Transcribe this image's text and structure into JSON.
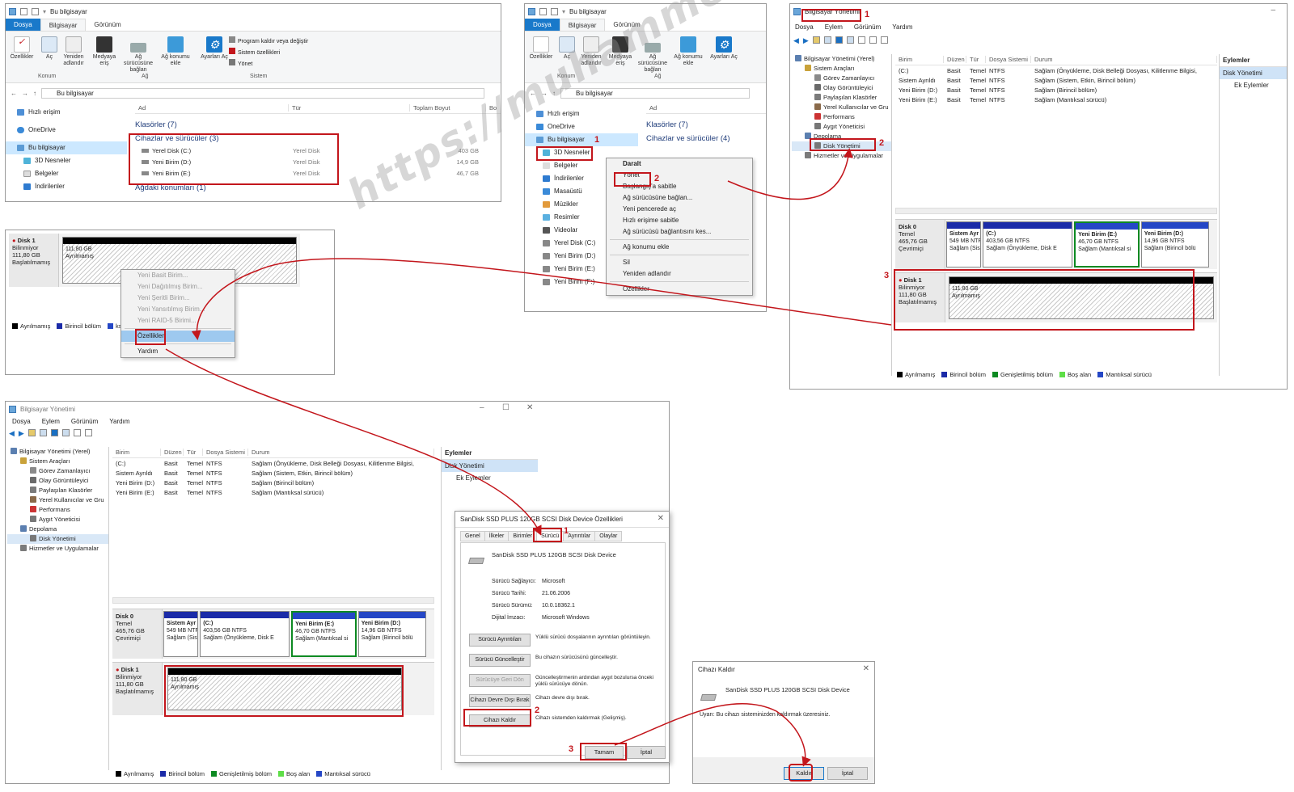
{
  "watermark": "https://muhammedyusufolgun.blogspot.com",
  "explorer": {
    "title": "Bu bilgisayar",
    "tabs": [
      "Dosya",
      "Bilgisayar",
      "Görünüm"
    ],
    "ribbon": {
      "items": [
        "Özellikler",
        "Aç",
        "Yeniden adlandır",
        "Medyaya eriş",
        "Ağ sürücüsüne bağlan",
        "Ağ konumu ekle",
        "Ayarları Aç"
      ],
      "system_items": [
        "Program kaldır veya değiştir",
        "Sistem özellikleri",
        "Yönet"
      ],
      "groups": [
        "Konum",
        "Ağ",
        "Sistem"
      ]
    },
    "address": "Bu bilgisayar",
    "nav": [
      "Hızlı erişim",
      "OneDrive",
      "Bu bilgisayar",
      "3D Nesneler",
      "Belgeler",
      "İndirilenler"
    ],
    "columns": [
      "Ad",
      "Tür",
      "Toplam Boyut",
      "Bo"
    ],
    "folders_group": "Klasörler (7)",
    "devices_group": "Cihazlar ve sürücüler (3)",
    "drives": [
      {
        "name": "Yerel Disk (C:)",
        "type": "Yerel Disk",
        "size": "403 GB"
      },
      {
        "name": "Yeni Birim (D:)",
        "type": "Yerel Disk",
        "size": "14,9 GB"
      },
      {
        "name": "Yeni Birim (E:)",
        "type": "Yerel Disk",
        "size": "46,7 GB"
      }
    ],
    "network_group": "Ağdaki konumları (1)"
  },
  "explorer2": {
    "title": "Bu bilgisayar",
    "tabs": [
      "Dosya",
      "Bilgisayar",
      "Görünüm"
    ],
    "ribbon_items": [
      "Özellikler",
      "Aç",
      "Yeniden adlandır",
      "Medyaya eriş",
      "Ağ sürücüsüne bağlan",
      "Ağ konumu ekle",
      "Ayarları Aç"
    ],
    "groups": [
      "Konum",
      "Ağ"
    ],
    "address": "Bu bilgisayar",
    "nav": [
      "Hızlı erişim",
      "OneDrive",
      "Bu bilgisayar",
      "3D Nesneler",
      "Belgeler",
      "İndirilenler",
      "Masaüstü",
      "Müzikler",
      "Resimler",
      "Videolar",
      "Yerel Disk (C:)",
      "Yeni Birim (D:)",
      "Yeni Birim (E:)",
      "Yeni Birim (F:)"
    ],
    "col_ad": "Ad",
    "folders_group": "Klasörler (7)",
    "devices_group": "Cihazlar ve sürücüler (4)",
    "context_menu": [
      "Daralt",
      "Yönet",
      "Başlangıç'a sabitle",
      "Ağ sürücüsüne bağlan...",
      "Yeni pencerede aç",
      "Hızlı erişime sabitle",
      "Ağ sürücüsü bağlantısını kes...",
      "Ağ konumu ekle",
      "Sil",
      "Yeniden adlandır",
      "Özellikler"
    ],
    "step1": "1",
    "step2": "2"
  },
  "compmgmt": {
    "title": "Bilgisayar Yönetimi",
    "menu": [
      "Dosya",
      "Eylem",
      "Görünüm",
      "Yardım"
    ],
    "tree": [
      "Bilgisayar Yönetimi (Yerel)",
      "Sistem Araçları",
      "Görev Zamanlayıcı",
      "Olay Görüntüleyici",
      "Paylaşılan Klasörler",
      "Yerel Kullanıcılar ve Gru",
      "Performans",
      "Aygıt Yöneticisi",
      "Depolama",
      "Disk Yönetimi",
      "Hizmetler ve Uygulamalar"
    ],
    "columns": [
      "Birim",
      "Düzen",
      "Tür",
      "Dosya Sistemi",
      "Durum"
    ],
    "volumes": [
      [
        "(C:)",
        "Basit",
        "Temel",
        "NTFS",
        "Sağlam (Önyükleme, Disk Belleği Dosyası, Kilitlenme Bilgisi,"
      ],
      [
        "Sistem Ayrıldı",
        "Basit",
        "Temel",
        "NTFS",
        "Sağlam (Sistem, Etkin, Birincil bölüm)"
      ],
      [
        "Yeni Birim (D:)",
        "Basit",
        "Temel",
        "NTFS",
        "Sağlam (Birincil bölüm)"
      ],
      [
        "Yeni Birim (E:)",
        "Basit",
        "Temel",
        "NTFS",
        "Sağlam (Mantıksal sürücü)"
      ]
    ],
    "actions_title": "Eylemler",
    "actions": [
      "Disk Yönetimi",
      "Ek Eylemler"
    ],
    "disk0": {
      "name": "Disk 0",
      "lines": [
        "Temel",
        "465,76 GB",
        "Çevrimiçi"
      ]
    },
    "disk0_parts": [
      {
        "t": "Sistem Ayr",
        "s": "549 MB NTF",
        "h": "Sağlam (Sis"
      },
      {
        "t": "(C:)",
        "s": "403,56 GB NTFS",
        "h": "Sağlam (Önyükleme, Disk E"
      },
      {
        "t": "Yeni Birim  (E:)",
        "s": "46,70 GB NTFS",
        "h": "Sağlam (Mantıksal si"
      },
      {
        "t": "Yeni Birim  (D:)",
        "s": "14,96 GB NTFS",
        "h": "Sağlam (Birincil bölü"
      }
    ],
    "disk1": {
      "name": "Disk 1",
      "lines": [
        "Bilinmiyor",
        "111,80 GB",
        "Başlatılmamış"
      ]
    },
    "disk1_part": {
      "s": "111,80 GB",
      "h": "Ayrılmamış"
    },
    "legend": [
      "Ayrılmamış",
      "Birincil bölüm",
      "Genişletilmiş bölüm",
      "Boş alan",
      "Mantıksal sürücü"
    ],
    "steps": [
      "1",
      "2",
      "3"
    ]
  },
  "ctxdisk": {
    "disk": {
      "name": "Disk 1",
      "lines": [
        "Bilinmiyor",
        "111,80 GB",
        "Başlatılmamış"
      ]
    },
    "part": {
      "s": "111,80 GB",
      "h": "Ayrılmamış"
    },
    "menu": [
      "Yeni Basit Birim...",
      "Yeni Dağıtılmış Birim...",
      "Yeni Şeritli Birim...",
      "Yeni Yansıtılmış Birim...",
      "Yeni RAID-5 Birimi...",
      "Özellikler",
      "Yardım"
    ],
    "legend": [
      "Ayrılmamış",
      "Birincil bölüm",
      "ksal sürücü"
    ]
  },
  "compmgmt2": {
    "title": "Bilgisayar Yönetimi",
    "menu": [
      "Dosya",
      "Eylem",
      "Görünüm",
      "Yardım"
    ]
  },
  "props": {
    "title": "SanDisk SSD PLUS 120GB SCSI Disk Device Özellikleri",
    "tabs": [
      "Genel",
      "İlkeler",
      "Birimler",
      "Sürücü",
      "Ayrıntılar",
      "Olaylar"
    ],
    "device": "SanDisk SSD PLUS 120GB SCSI Disk Device",
    "fields": [
      {
        "k": "Sürücü Sağlayıcı:",
        "v": "Microsoft"
      },
      {
        "k": "Sürücü Tarihi:",
        "v": "21.06.2006"
      },
      {
        "k": "Sürücü Sürümü:",
        "v": "10.0.18362.1"
      },
      {
        "k": "Dijital İmzacı:",
        "v": "Microsoft Windows"
      }
    ],
    "buttons": [
      {
        "b": "Sürücü Ayrıntıları",
        "d": "Yüklü sürücü dosyalarının ayrıntıları görüntüleyin."
      },
      {
        "b": "Sürücü Güncelleştir",
        "d": "Bu cihazın sürücüsünü güncelleştir."
      },
      {
        "b": "Sürücüye Geri Dön",
        "d": "Güncelleştirmenin ardından aygıt bozulursa önceki yüklü sürücüye dönün."
      },
      {
        "b": "Cihazı Devre Dışı Bırak",
        "d": "Cihazı devre dışı bırak."
      },
      {
        "b": "Cihazı Kaldır",
        "d": "Cihazı sistemden kaldırmak (Gelişmiş)."
      }
    ],
    "ok": "Tamam",
    "cancel": "İptal",
    "steps": [
      "1",
      "2",
      "3"
    ]
  },
  "remove": {
    "title": "Cihazı Kaldır",
    "device": "SanDisk SSD PLUS 120GB SCSI Disk Device",
    "warning": "Uyarı: Bu cihazı sisteminizden kaldırmak üzeresiniz.",
    "ok": "Kaldır",
    "cancel": "İptal"
  },
  "colors": {
    "accent": "#1979ca",
    "red": "#c3161c",
    "unalloc": "#000000",
    "primary": "#1b2ba8",
    "extended": "#0d8a22",
    "free": "#5ede47",
    "logical": "#2547c6"
  }
}
